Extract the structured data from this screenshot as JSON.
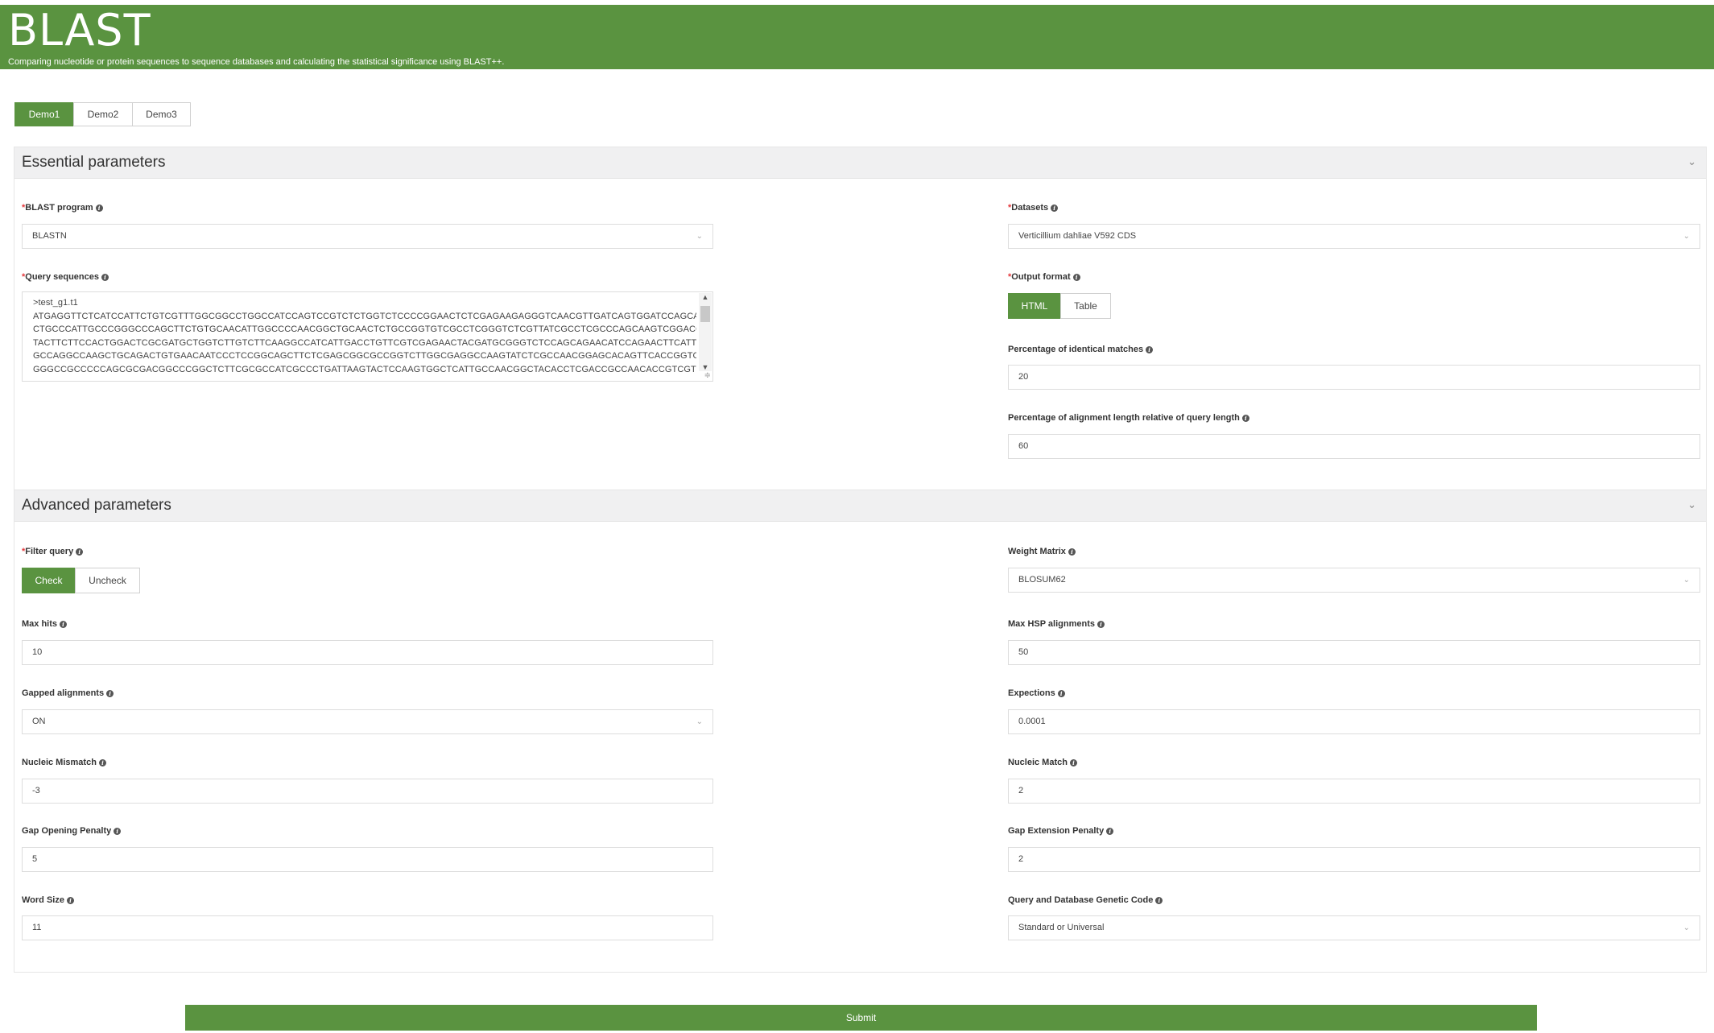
{
  "header": {
    "title": "BLAST",
    "subtitle": "Comparing nucleotide or protein sequences to sequence databases and calculating the statistical significance using BLAST++."
  },
  "demo_tabs": [
    {
      "label": "Demo1",
      "active": true
    },
    {
      "label": "Demo2",
      "active": false
    },
    {
      "label": "Demo3",
      "active": false
    }
  ],
  "essential": {
    "title": "Essential parameters",
    "blast_program": {
      "required": "*",
      "label": "BLAST program",
      "value": "BLASTN"
    },
    "query_sequences": {
      "required": "*",
      "label": "Query sequences",
      "value": ">test_g1.t1\nATGAGGTTCTCATCCATTCTGTCGTTTGGCGGCCTGGCCATCCAGTCCGTCTCTGGTCTCCCCGGAACTCTCGAGAAGAGGGTCAACGTTGATCAGTGGATCCAGCAGGAG\nCTGCCCATTGCCCGGGCCCAGCTTCTGTGCAACATTGGCCCCAACGGCTGCAACTCTGCCGGTGTCGCCTCGGGTCTCGTTATCGCCTCGCCCAGCAAGTCGGACCCTGAC\nTACTTCTTCCACTGGACTCGCGATGCTGGTCTTGTCTTCAAGGCCATCATTGACCTGTTCGTCGAGAACTACGATGCGGGTCTCCAGCAGAACATCCAGAACTTCATTGTCG\nGCCAGGCCAAGCTGCAGACTGTGAACAATCCCTCCGGCAGCTTCTCGAGCGGCGCCGGTCTTGGCGAGGCCAAGTATCTCGCCAACGGAGCACAGTTCACCGGTGACTG\nGGGCCGCCCCCAGCGCGACGGCCCGGCTCTTCGCGCCATCGCCCTGATTAAGTACTCCAAGTGGCTCATTGCCAACGGCTACACCTCGACCGCCAACACCGTCGTCTGGC"
    },
    "datasets": {
      "required": "*",
      "label": "Datasets",
      "value": "Verticillium dahliae V592 CDS"
    },
    "output_format": {
      "required": "*",
      "label": "Output format",
      "options": [
        {
          "label": "HTML",
          "active": true
        },
        {
          "label": "Table",
          "active": false
        }
      ]
    },
    "pct_identical": {
      "label": "Percentage of identical matches",
      "value": "20"
    },
    "pct_alignment": {
      "label": "Percentage of alignment length relative of query length",
      "value": "60"
    }
  },
  "advanced": {
    "title": "Advanced parameters",
    "filter_query": {
      "required": "*",
      "label": "Filter query",
      "options": [
        {
          "label": "Check",
          "active": true
        },
        {
          "label": "Uncheck",
          "active": false
        }
      ]
    },
    "weight_matrix": {
      "label": "Weight Matrix",
      "value": "BLOSUM62"
    },
    "max_hits": {
      "label": "Max hits",
      "value": "10"
    },
    "max_hsp": {
      "label": "Max HSP alignments",
      "value": "50"
    },
    "gapped": {
      "label": "Gapped alignments",
      "value": "ON"
    },
    "expections": {
      "label": "Expections",
      "value": "0.0001"
    },
    "nucleic_mismatch": {
      "label": "Nucleic Mismatch",
      "value": "-3"
    },
    "nucleic_match": {
      "label": "Nucleic Match",
      "value": "2"
    },
    "gap_open": {
      "label": "Gap Opening Penalty",
      "value": "5"
    },
    "gap_ext": {
      "label": "Gap Extension Penalty",
      "value": "2"
    },
    "word_size": {
      "label": "Word Size",
      "value": "11"
    },
    "genetic_code": {
      "label": "Query and Database Genetic Code",
      "value": "Standard or Universal"
    }
  },
  "submit_label": "Submit",
  "colors": {
    "brand_green": "#5a9340",
    "required_red": "#e4393c"
  }
}
